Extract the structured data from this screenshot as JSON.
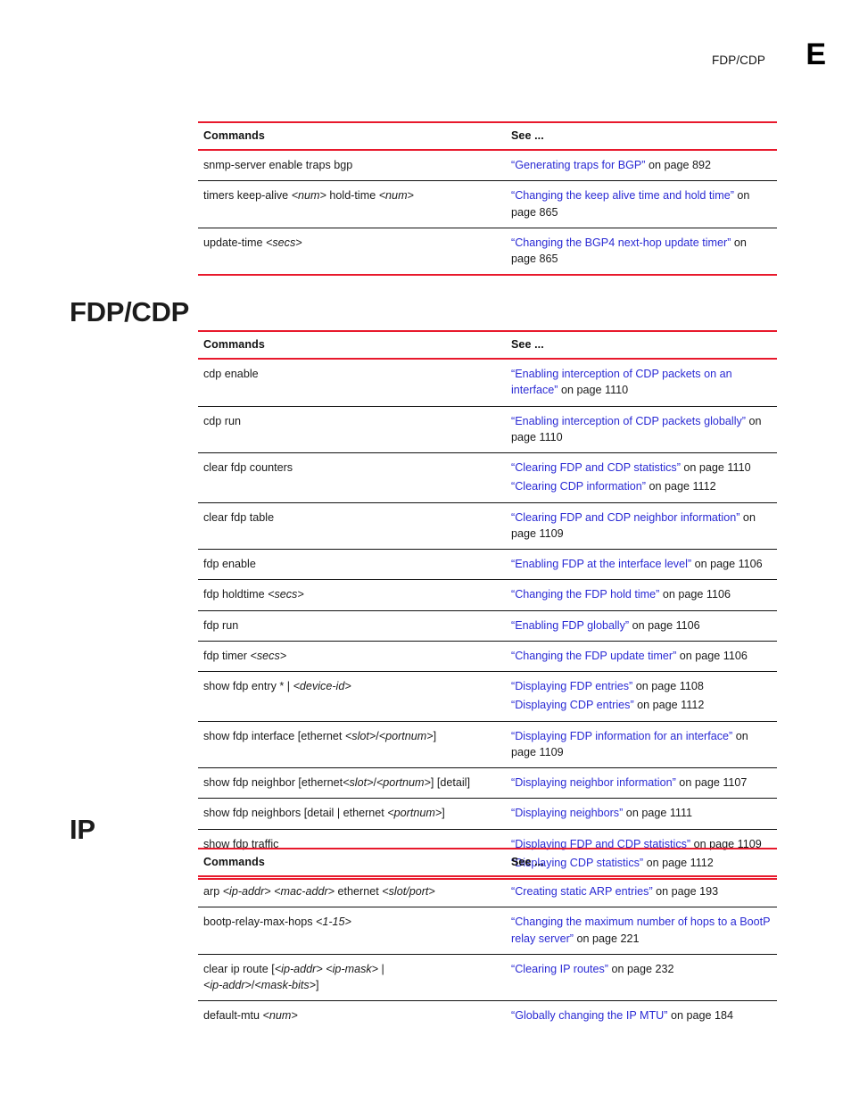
{
  "header": {
    "running_title": "FDP/CDP",
    "appendix_letter": "E"
  },
  "sections": [
    {
      "id": "bgp",
      "heading": null,
      "table": {
        "columns": [
          "Commands",
          "See ..."
        ],
        "closed": true,
        "rows": [
          {
            "command": [
              {
                "text": "snmp-server enable traps bgp",
                "style": "normal"
              }
            ],
            "see": [
              {
                "link": "“Generating traps for BGP”",
                "tail": " on page 892"
              }
            ]
          },
          {
            "command": [
              {
                "text": "timers keep-alive ",
                "style": "normal"
              },
              {
                "text": "<num>",
                "style": "italic"
              },
              {
                "text": " hold-time ",
                "style": "normal"
              },
              {
                "text": "<num>",
                "style": "italic"
              }
            ],
            "see": [
              {
                "link": "“Changing the keep alive time and hold time”",
                "tail": " on page 865"
              }
            ]
          },
          {
            "command": [
              {
                "text": "update-time ",
                "style": "normal"
              },
              {
                "text": "<secs>",
                "style": "italic"
              }
            ],
            "see": [
              {
                "link": "“Changing the BGP4 next-hop update timer”",
                "tail": " on page 865"
              }
            ]
          }
        ]
      }
    },
    {
      "id": "fdpcdp",
      "heading": "FDP/CDP",
      "table": {
        "columns": [
          "Commands",
          "See ..."
        ],
        "closed": true,
        "rows": [
          {
            "command": [
              {
                "text": "cdp enable",
                "style": "normal"
              }
            ],
            "see": [
              {
                "link": "“Enabling interception of CDP packets on an interface”",
                "tail": " on page 1110"
              }
            ]
          },
          {
            "command": [
              {
                "text": "cdp run",
                "style": "normal"
              }
            ],
            "see": [
              {
                "link": "“Enabling interception of CDP packets globally”",
                "tail": " on page 1110"
              }
            ]
          },
          {
            "command": [
              {
                "text": "clear fdp counters",
                "style": "normal"
              }
            ],
            "see": [
              {
                "link": "“Clearing FDP and CDP statistics”",
                "tail": " on page 1110"
              },
              {
                "link": "“Clearing CDP information”",
                "tail": " on page 1112"
              }
            ]
          },
          {
            "command": [
              {
                "text": "clear fdp table",
                "style": "normal"
              }
            ],
            "see": [
              {
                "link": "“Clearing FDP and CDP neighbor information”",
                "tail": " on page 1109"
              }
            ]
          },
          {
            "command": [
              {
                "text": "fdp enable",
                "style": "normal"
              }
            ],
            "see": [
              {
                "link": "“Enabling FDP at the interface level”",
                "tail": " on page 1106"
              }
            ]
          },
          {
            "command": [
              {
                "text": "fdp holdtime ",
                "style": "normal"
              },
              {
                "text": "<secs>",
                "style": "italic"
              }
            ],
            "see": [
              {
                "link": "“Changing the FDP hold time”",
                "tail": " on page 1106"
              }
            ]
          },
          {
            "command": [
              {
                "text": "fdp run",
                "style": "normal"
              }
            ],
            "see": [
              {
                "link": "“Enabling FDP globally”",
                "tail": " on page 1106"
              }
            ]
          },
          {
            "command": [
              {
                "text": "fdp timer ",
                "style": "normal"
              },
              {
                "text": "<secs>",
                "style": "italic"
              }
            ],
            "see": [
              {
                "link": "“Changing the FDP update timer”",
                "tail": " on page 1106"
              }
            ]
          },
          {
            "command": [
              {
                "text": "show fdp entry * | ",
                "style": "normal"
              },
              {
                "text": "<device-id>",
                "style": "italic"
              }
            ],
            "see": [
              {
                "link": "“Displaying FDP entries”",
                "tail": " on page 1108"
              },
              {
                "link": "“Displaying CDP entries”",
                "tail": " on page 1112"
              }
            ]
          },
          {
            "command": [
              {
                "text": "show fdp interface [ethernet ",
                "style": "normal"
              },
              {
                "text": "<slot>",
                "style": "italic"
              },
              {
                "text": "/",
                "style": "normal"
              },
              {
                "text": "<portnum>",
                "style": "italic"
              },
              {
                "text": "]",
                "style": "normal"
              }
            ],
            "see": [
              {
                "link": "“Displaying FDP information for an interface”",
                "tail": " on page 1109"
              }
            ]
          },
          {
            "command": [
              {
                "text": "show fdp neighbor [ethernet",
                "style": "normal"
              },
              {
                "text": "<slot>",
                "style": "italic"
              },
              {
                "text": "/",
                "style": "normal"
              },
              {
                "text": "<portnum>",
                "style": "italic"
              },
              {
                "text": "] [detail]",
                "style": "normal"
              }
            ],
            "see": [
              {
                "link": "“Displaying neighbor information”",
                "tail": " on page 1107"
              }
            ]
          },
          {
            "command": [
              {
                "text": "show fdp neighbors [detail | ethernet ",
                "style": "normal"
              },
              {
                "text": "<portnum>",
                "style": "italic"
              },
              {
                "text": "]",
                "style": "normal"
              }
            ],
            "see": [
              {
                "link": "“Displaying neighbors”",
                "tail": " on page 1111"
              }
            ]
          },
          {
            "command": [
              {
                "text": "show fdp traffic",
                "style": "normal"
              }
            ],
            "see": [
              {
                "link": "“Displaying FDP and CDP statistics”",
                "tail": " on page 1109"
              },
              {
                "link": "“Displaying CDP statistics”",
                "tail": " on page 1112"
              }
            ]
          }
        ]
      }
    },
    {
      "id": "ip",
      "heading": "IP",
      "table": {
        "columns": [
          "Commands",
          "See ..."
        ],
        "closed": false,
        "rows": [
          {
            "command": [
              {
                "text": "arp ",
                "style": "normal"
              },
              {
                "text": "<ip-addr>",
                "style": "italic"
              },
              {
                "text": " ",
                "style": "normal"
              },
              {
                "text": "<mac-addr>",
                "style": "italic"
              },
              {
                "text": " ethernet ",
                "style": "normal"
              },
              {
                "text": "<slot/port>",
                "style": "italic"
              }
            ],
            "see": [
              {
                "link": "“Creating static ARP entries”",
                "tail": " on page 193"
              }
            ]
          },
          {
            "command": [
              {
                "text": "bootp-relay-max-hops ",
                "style": "normal"
              },
              {
                "text": "<1-15>",
                "style": "italic"
              }
            ],
            "see": [
              {
                "link": "“Changing the maximum number of hops to a BootP relay server”",
                "tail": " on page 221"
              }
            ]
          },
          {
            "command": [
              {
                "text": "clear ip route [",
                "style": "normal"
              },
              {
                "text": "<ip-addr>",
                "style": "italic"
              },
              {
                "text": " ",
                "style": "normal"
              },
              {
                "text": "<ip-mask>",
                "style": "italic"
              },
              {
                "text": "  |",
                "style": "normal"
              },
              {
                "text": "\n",
                "style": "break"
              },
              {
                "text": "<ip-addr>",
                "style": "italic"
              },
              {
                "text": "/",
                "style": "normal"
              },
              {
                "text": "<mask-bits>",
                "style": "italic"
              },
              {
                "text": "]",
                "style": "normal"
              }
            ],
            "see": [
              {
                "link": "“Clearing IP routes”",
                "tail": " on page 232"
              }
            ]
          },
          {
            "command": [
              {
                "text": "default-mtu ",
                "style": "normal"
              },
              {
                "text": "<num>",
                "style": "italic"
              }
            ],
            "see": [
              {
                "link": "“Globally changing the IP MTU”",
                "tail": " on page 184"
              }
            ]
          }
        ]
      }
    }
  ],
  "colors": {
    "rule_red": "#e8192c",
    "link_blue": "#2b2bd4",
    "text_black": "#1a1a1a"
  }
}
